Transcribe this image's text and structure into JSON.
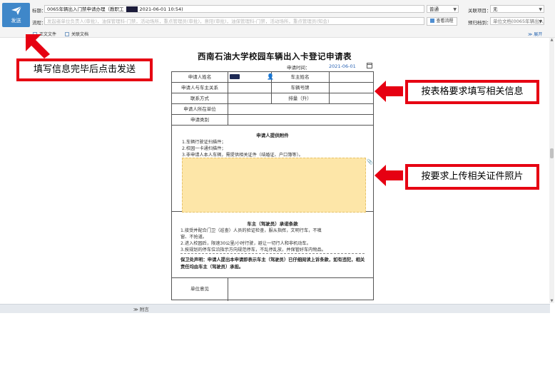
{
  "header": {
    "send_label": "发送",
    "title_label": "标题：",
    "title_value_prefix": "0065年辆出入门禁申请办理（教职工",
    "title_value_suffix": "2021-06-01 10:54)",
    "flow_label": "流程：",
    "flow_value": "发起者单位负责人(审批)，油保管理科-门禁，活动场所，重点管理员(审批)，意阳(审批)，油保管理科-门禁，活动场所，重点管理员(知会)",
    "priority_value": "普通",
    "related_project_label": "关联项目：",
    "related_project_value": "无",
    "archive_label": "预归档到：",
    "archive_value": "单位文档(0065年辆出入",
    "view_flow_label": "查看流程",
    "body_file_label": "正文文件",
    "related_doc_label": "关联文档",
    "expand_label": "展开"
  },
  "form": {
    "title": "西南石油大学校园车辆出入卡登记申请表",
    "apply_time_label": "申请时间：",
    "apply_time_value": "2021-06-01",
    "applicant_name_label": "申请人姓名",
    "owner_name_label": "车主姓名",
    "relation_label": "申请人与车主关系",
    "plate_label": "车辆号牌",
    "contact_label": "联系方式",
    "displacement_label": "排量（升）",
    "unit_label": "申请人所在单位",
    "category_label": "申请类别",
    "attachments_title": "申请人提供附件",
    "attachments_notes": [
      "1.车辆行驶证扫描件；",
      "2.校园一卡通扫描件；",
      "3.非申请人本人车辆，需提供相关证件（结婚证、户口簿等）。"
    ],
    "pledge_title": "车主（驾驶员）承诺条款",
    "pledge_items": [
      "1.接受并配合门卫（巡查）人员的验证检查，服从指挥，文明行车，不嗔",
      "   窗、不抢道。",
      "2.进入校园后，限速30公里/小时行驶，避让一切行人和非机动车。",
      "3.按规划的停车位沿指示方向规范停车，不乱停乱放，并保管好车内物品。"
    ],
    "statement": "保卫处声明：申请人提出本申请即表示车主（驾驶员）已仔细阅读上诉条款，如有违犯，相关责任均由车主（驾驶员）承担。",
    "unit_opinion_label": "单位意见"
  },
  "footer": {
    "attachments_label": "附言"
  },
  "callouts": {
    "send_hint": "填写信息完毕后点击发送",
    "fill_hint": "按表格要求填写相关信息",
    "upload_hint": "按要求上传相关证件照片"
  },
  "colors": {
    "accent_blue": "#3f87c9",
    "callout_red": "#e60012",
    "upload_fill": "#fde6a8"
  }
}
